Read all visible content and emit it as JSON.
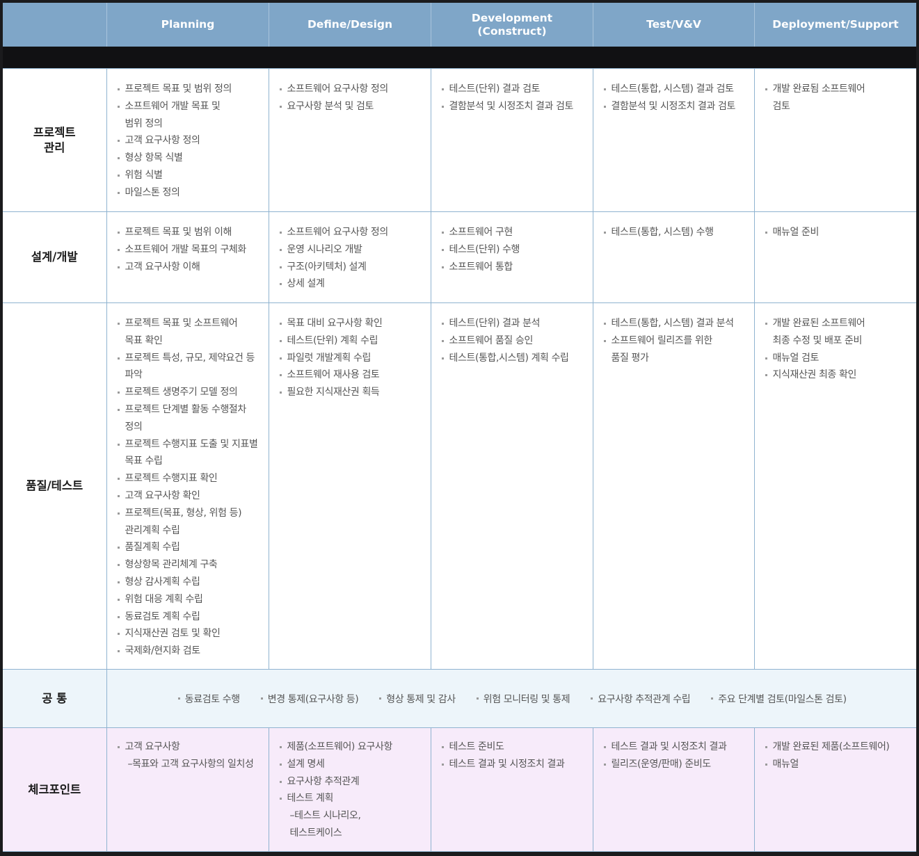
{
  "header": {
    "columns": [
      "Planning",
      "Define/Design",
      "Development\n(Construct)",
      "Test/V&V",
      "Deployment/Support"
    ]
  },
  "rows": [
    {
      "label": "프로젝트\n관리",
      "cells": [
        [
          "프로젝트 목표 및 범위 정의",
          "소프트웨어 개발 목표 및\n범위 정의",
          "고객 요구사항 정의",
          "형상 항목 식별",
          "위험 식별",
          "마일스톤 정의"
        ],
        [
          "소프트웨어 요구사항 정의",
          "요구사항 분석 및 검토"
        ],
        [
          "테스트(단위) 결과 검토",
          "결함분석 및 시정조치 결과 검토"
        ],
        [
          "테스트(통합, 시스템) 결과 검토",
          "결함분석 및 시정조치 결과 검토"
        ],
        [
          "개발 완료됨 소프트웨어\n검토"
        ]
      ]
    },
    {
      "label": "설계/개발",
      "cells": [
        [
          "프로젝트 목표 및 범위 이해",
          "소프트웨어 개발 목표의 구체화",
          "고객 요구사항 이해"
        ],
        [
          "소프트웨어 요구사항 정의",
          "운영 시나리오 개발",
          "구조(아키텍처) 설계",
          "상세 설계"
        ],
        [
          "소프트웨어 구현",
          "테스트(단위) 수행",
          "소프트웨어 통합"
        ],
        [
          "테스트(통합, 시스템) 수행"
        ],
        [
          "매뉴얼 준비"
        ]
      ]
    },
    {
      "label": "품질/테스트",
      "cells": [
        [
          "프로젝트 목표 및 소프트웨어\n목표 확인",
          "프로젝트 특성, 규모, 제약요건 등\n파악",
          "프로젝트 생명주기 모델 정의",
          "프로젝트 단계별 활동 수행절차\n정의",
          "프로젝트 수행지표 도출 및 지표별\n목표 수립",
          "프로젝트 수행지표 확인",
          "고객 요구사항 확인",
          "프로젝트(목표, 형상, 위험 등)\n관리계획 수립",
          "품질계획 수립",
          "형상항목 관리체계 구축",
          "형상 감사계획 수립",
          "위험 대응 계획 수립",
          "동료검토 계획 수립",
          "지식재산권 검토 및 확인",
          "국제화/현지화 검토"
        ],
        [
          "목표 대비 요구사항 확인",
          "테스트(단위) 계획 수립",
          "파일럿 개발계획 수립",
          "소프트웨어 재사용 검토",
          "필요한 지식재산권 획득"
        ],
        [
          "테스트(단위) 결과 분석",
          "소프트웨어 품질 승인",
          "테스트(통합,시스템) 계획 수립"
        ],
        [
          "테스트(통합, 시스템) 결과 분석",
          "소프트웨어 릴리즈를 위한\n품질 평가"
        ],
        [
          "개발 완료된 소프트웨어\n최종 수정 및 배포 준비",
          "매뉴얼 검토",
          "지식재산권 최종 확인"
        ]
      ]
    }
  ],
  "common": {
    "label": "공 통",
    "items": [
      "동료검토 수행",
      "변경 통제(요구사항 등)",
      "형상 통제 및 감사",
      "위험 모니터링 및 통제",
      "요구사항 추적관계 수립",
      "주요 단계별 검토(마일스톤 검토)"
    ]
  },
  "checkpoint": {
    "label": "체크포인트",
    "cells": [
      [
        {
          "text": "고객 요구사항",
          "sub": "–목표와 고객 요구사항의 일치성"
        }
      ],
      [
        {
          "text": "제품(소프트웨어) 요구사항"
        },
        {
          "text": "설계 명세"
        },
        {
          "text": "요구사항 추적관계"
        },
        {
          "text": "테스트 계획",
          "sub": "–테스트 시나리오,\n  테스트케이스"
        }
      ],
      [
        {
          "text": "테스트 준비도"
        },
        {
          "text": "테스트 결과 및 시정조치 결과"
        }
      ],
      [
        {
          "text": "테스트 결과 및 시정조치 결과"
        },
        {
          "text": "릴리즈(운영/판매) 준비도"
        }
      ],
      [
        {
          "text": "개발 완료된 제품(소프트웨어)"
        },
        {
          "text": "매뉴얼"
        }
      ]
    ]
  }
}
